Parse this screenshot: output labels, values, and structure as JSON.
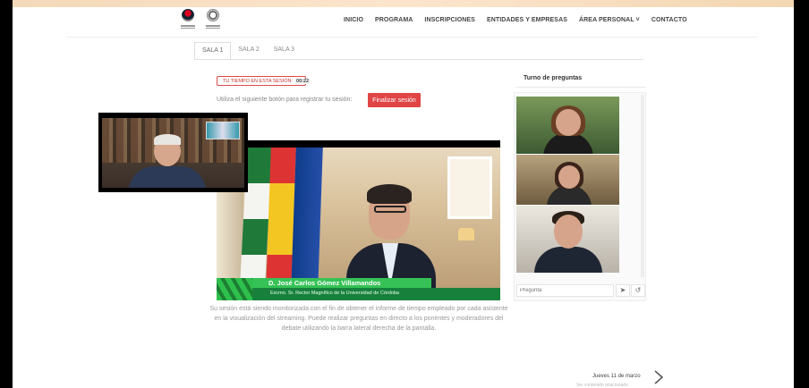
{
  "nav": {
    "items": [
      "INICIO",
      "PROGRAMA",
      "INSCRIPCIONES",
      "ENTIDADES Y EMPRESAS",
      "ÁREA PERSONAL ˅",
      "CONTACTO"
    ]
  },
  "tabs": [
    "SALA 1",
    "SALA 2",
    "SALA 3"
  ],
  "session": {
    "timer_label": "TU TIEMPO EN ESTA SESIÓN:",
    "timer_value": "00:22",
    "instruction": "Utiliza el siguiente botón para registrar tu sesión:",
    "end_button": "Finalizar sesión"
  },
  "video": {
    "speaker_name": "D. José Carlos Gómez Villamandos",
    "speaker_role": "Excmo. Sr. Rector Magnífico de la Universidad de Córdoba"
  },
  "description": "Su sesión está siendo monitorizada con el fin de obtener el informe de tiempo empleado por cada asistente en la visualización del streaming. Puede realizar preguntas en directo a los ponentes y moderadores del debate utilizando la barra lateral derecha de la pantalla.",
  "questions": {
    "title": "Turno de preguntas",
    "placeholder": "Pregunta",
    "send_icon": "send-icon",
    "reset_icon": "reset-icon"
  },
  "footer": {
    "next_day": "Jueves 11 de marzo",
    "next_sub": "Ver contenido relacionado"
  },
  "colors": {
    "accent_red": "#e04545",
    "lower_third_green": "#36c256"
  }
}
